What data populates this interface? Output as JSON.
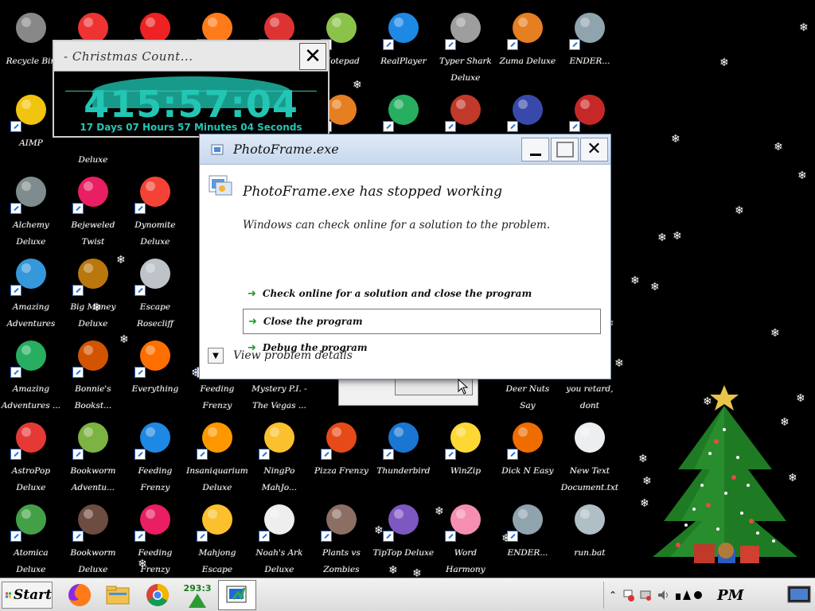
{
  "desktop": {
    "icons": [
      {
        "label": "Recycle Bin",
        "shortcut": false
      },
      {
        "label": "",
        "shortcut": true
      },
      {
        "label": "",
        "shortcut": true
      },
      {
        "label": "",
        "shortcut": true
      },
      {
        "label": "",
        "shortcut": true
      },
      {
        "label": "Notepad",
        "shortcut": true
      },
      {
        "label": "RealPlayer",
        "shortcut": true
      },
      {
        "label": "Typer Shark\nDeluxe",
        "shortcut": true
      },
      {
        "label": "Zuma Deluxe",
        "shortcut": true
      },
      {
        "label": "ENDER...",
        "shortcut": true
      },
      {
        "label": "AIMP",
        "shortcut": true
      },
      {
        "label": "\nDeluxe",
        "shortcut": true
      },
      {
        "label": "",
        "shortcut": true
      },
      {
        "label": "",
        "shortcut": true
      },
      {
        "label": "",
        "shortcut": true
      },
      {
        "label": "",
        "shortcut": true
      },
      {
        "label": "",
        "shortcut": true
      },
      {
        "label": "",
        "shortcut": true
      },
      {
        "label": "",
        "shortcut": true
      },
      {
        "label": "",
        "shortcut": true
      },
      {
        "label": "Alchemy\nDeluxe",
        "shortcut": true
      },
      {
        "label": "Bejeweled Twist",
        "shortcut": true
      },
      {
        "label": "Dynomite\nDeluxe",
        "shortcut": true
      },
      {
        "label": "Amazing\nAdventures",
        "shortcut": true
      },
      {
        "label": "Big Money\nDeluxe",
        "shortcut": true
      },
      {
        "label": "Escape\nRosecliff Island",
        "shortcut": true
      },
      {
        "label": "Amazing\nAdventures ...",
        "shortcut": true
      },
      {
        "label": "Bonnie's\nBookst...",
        "shortcut": true
      },
      {
        "label": "Everything",
        "shortcut": true
      },
      {
        "label": "Feeding Frenzy\nDeluxe",
        "shortcut": true
      },
      {
        "label": "Mystery P.I. -\nThe Vegas ...",
        "shortcut": true
      },
      {
        "label": "",
        "shortcut": true
      },
      {
        "label": "Deer Nuts\nSay",
        "shortcut": true
      },
      {
        "label": "you retard, dont\nknow how to ...",
        "shortcut": false
      },
      {
        "label": "AstroPop\nDeluxe",
        "shortcut": true
      },
      {
        "label": "Bookworm\nAdventu...",
        "shortcut": true
      },
      {
        "label": "Feeding Frenzy\n2 Deluxe",
        "shortcut": true
      },
      {
        "label": "Insaniquarium\nDeluxe",
        "shortcut": true
      },
      {
        "label": "NingPo\nMahJo...",
        "shortcut": true
      },
      {
        "label": "Pizza Frenzy",
        "shortcut": true
      },
      {
        "label": "Thunderbird",
        "shortcut": true
      },
      {
        "label": "WinZip",
        "shortcut": true
      },
      {
        "label": "Dick N Easy",
        "shortcut": true
      },
      {
        "label": "New Text\nDocument.txt",
        "shortcut": false
      },
      {
        "label": "Atomica Deluxe",
        "shortcut": true
      },
      {
        "label": "Bookworm\nDeluxe",
        "shortcut": true
      },
      {
        "label": "Feeding Frenzy\nDeluxe",
        "shortcut": true
      },
      {
        "label": "Mahjong Escape\nAncient China",
        "shortcut": true
      },
      {
        "label": "Noah's Ark\nDeluxe",
        "shortcut": true
      },
      {
        "label": "Plants vs\nZombies",
        "shortcut": true
      },
      {
        "label": "TipTop Deluxe",
        "shortcut": true
      },
      {
        "label": "Word Harmony\nDeluxe",
        "shortcut": true
      },
      {
        "label": "ENDER...",
        "shortcut": true
      },
      {
        "label": "run.bat",
        "shortcut": false
      }
    ]
  },
  "countdown": {
    "title": "- Christmas Count...",
    "time": "415:57:04",
    "detail": "17 Days 07 Hours 57 Minutes 04 Seconds"
  },
  "dialog": {
    "title": "PhotoFrame.exe",
    "heading": "PhotoFrame.exe has stopped working",
    "description": "Windows can check online for a solution to the problem.",
    "options": [
      "Check online for a solution and close the program",
      "Close the program",
      "Debug the program"
    ],
    "details": "View problem details"
  },
  "taskbar": {
    "start_label": "Start",
    "counter": "293:3",
    "clock": "PM"
  }
}
